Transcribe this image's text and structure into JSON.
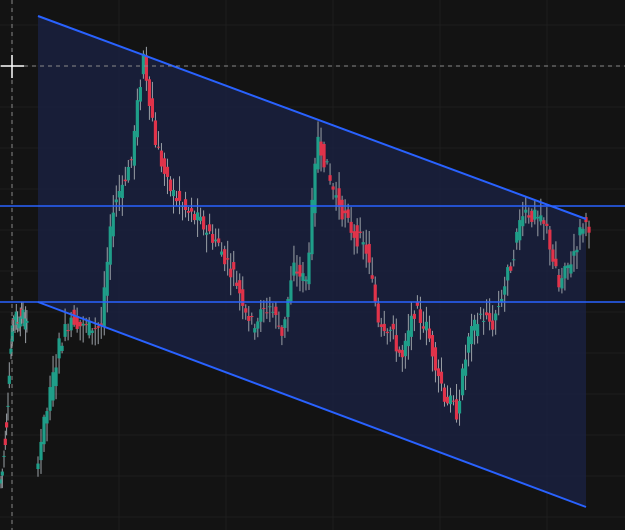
{
  "colors": {
    "background": "#131313",
    "grid": "#1e1e1e",
    "bull": "#1f9e89",
    "bear": "#e0334a",
    "wick": "#9aa0a6",
    "drawing": "#2962ff",
    "channel_fill": "#1a2140",
    "crosshair": "#8a8a8a"
  },
  "icons": {
    "cursor": "crosshair-cursor-icon"
  },
  "chart_data": {
    "type": "candlestick",
    "title": "",
    "xlabel": "",
    "ylabel": "",
    "ylim": [
      0,
      530
    ],
    "drawings": {
      "channel_upper": {
        "start": [
          0,
          514
        ],
        "end": [
          91,
          311
        ]
      },
      "channel_lower": {
        "start": [
          0,
          228
        ],
        "end": [
          91,
          23
        ]
      },
      "horizontal_lines": [
        324,
        228
      ]
    },
    "anchors": [
      [
        0,
        60
      ],
      [
        2,
        120
      ],
      [
        4,
        185
      ],
      [
        6,
        215
      ],
      [
        8,
        202
      ],
      [
        11,
        204
      ],
      [
        13,
        325
      ],
      [
        16,
        370
      ],
      [
        18,
        475
      ],
      [
        20,
        390
      ],
      [
        22,
        345
      ],
      [
        25,
        318
      ],
      [
        27,
        310
      ],
      [
        30,
        290
      ],
      [
        33,
        256
      ],
      [
        36,
        205
      ],
      [
        39,
        225
      ],
      [
        41,
        198
      ],
      [
        43,
        262
      ],
      [
        45,
        248
      ],
      [
        47,
        395
      ],
      [
        49,
        348
      ],
      [
        52,
        305
      ],
      [
        55,
        280
      ],
      [
        57,
        212
      ],
      [
        59,
        200
      ],
      [
        61,
        170
      ],
      [
        63,
        220
      ],
      [
        65,
        202
      ],
      [
        68,
        135
      ],
      [
        70,
        118
      ],
      [
        72,
        190
      ],
      [
        74,
        215
      ],
      [
        76,
        206
      ],
      [
        79,
        265
      ],
      [
        81,
        322
      ],
      [
        83,
        312
      ],
      [
        85,
        300
      ],
      [
        87,
        242
      ],
      [
        89,
        270
      ],
      [
        91,
        306
      ]
    ]
  }
}
